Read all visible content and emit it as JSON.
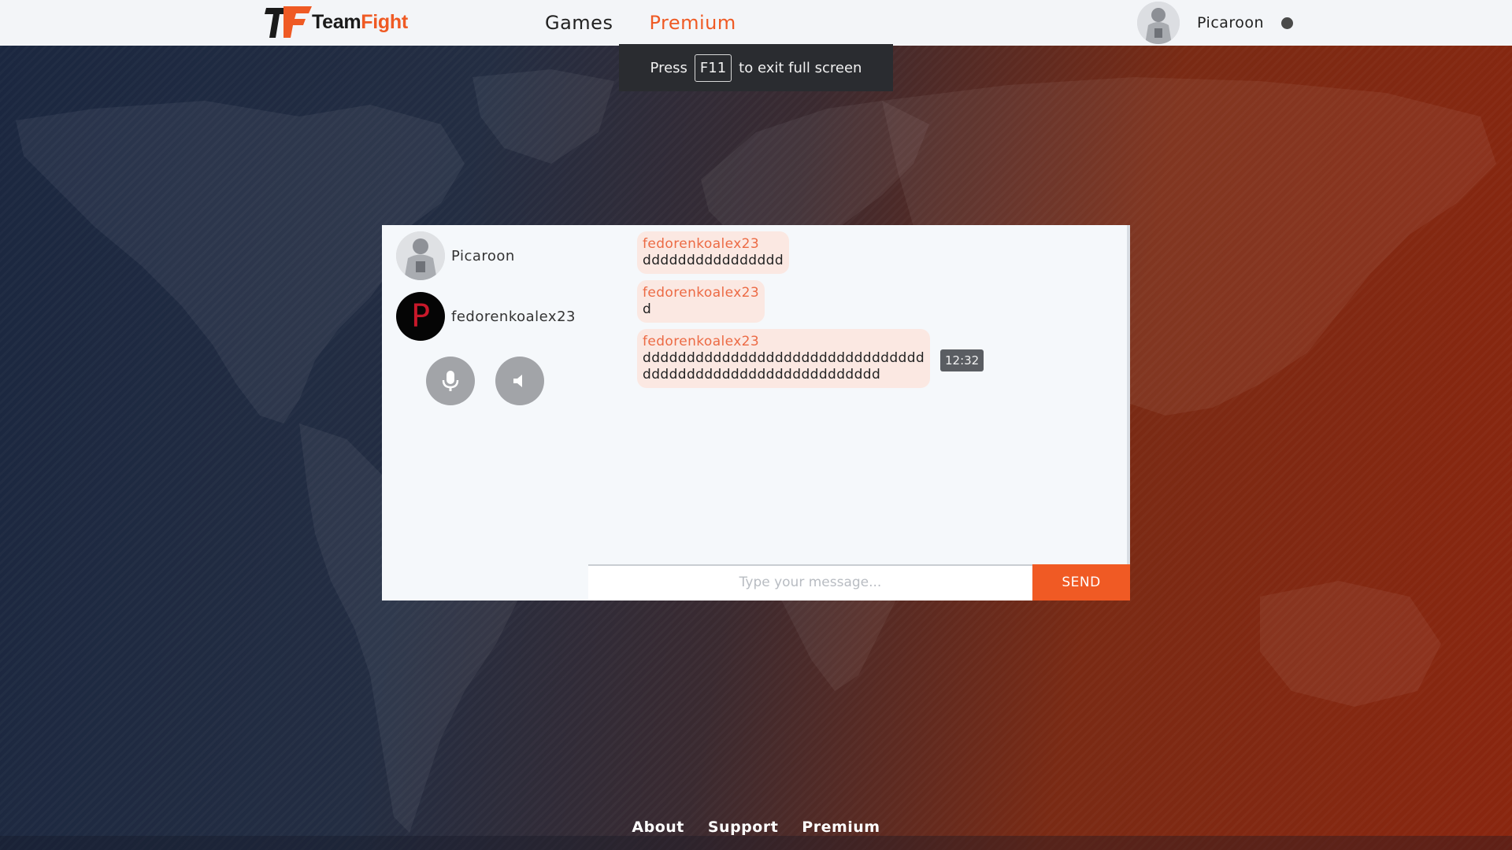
{
  "brand": {
    "name_part1": "Team",
    "name_part2": "Fight",
    "logo_letters": "TF",
    "accent_color": "#ef5a24"
  },
  "nav": {
    "items": [
      {
        "label": "Games",
        "active": false
      },
      {
        "label": "Premium",
        "active": true
      }
    ]
  },
  "user": {
    "name": "Picaroon",
    "status_color": "#4a4a4a"
  },
  "fullscreen_notice": {
    "before": "Press",
    "key": "F11",
    "after": "to exit full screen"
  },
  "chat": {
    "participants": [
      {
        "name": "Picaroon",
        "avatar": "photo"
      },
      {
        "name": "fedorenkoalex23",
        "avatar_letter": "P"
      }
    ],
    "controls": [
      {
        "icon": "microphone-icon"
      },
      {
        "icon": "speaker-icon"
      }
    ],
    "messages": [
      {
        "author": "fedorenkoalex23",
        "lines": [
          "dddddddddddddddd"
        ]
      },
      {
        "author": "fedorenkoalex23",
        "lines": [
          "d"
        ]
      },
      {
        "author": "fedorenkoalex23",
        "lines": [
          "dddddddddddddddddddddddddddddddd",
          "ddddddddddddddddddddddddddd"
        ],
        "time": "12:32"
      }
    ],
    "composer": {
      "placeholder": "Type your message...",
      "send_label": "SEND"
    }
  },
  "footer": {
    "links": [
      "About",
      "Support",
      "Premium"
    ]
  }
}
